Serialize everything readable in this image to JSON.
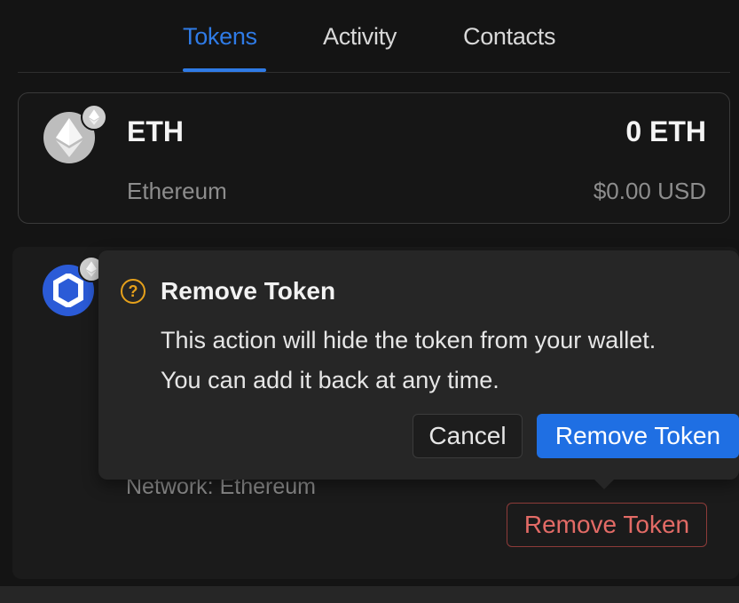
{
  "tabs": [
    {
      "label": "Tokens",
      "active": true
    },
    {
      "label": "Activity",
      "active": false
    },
    {
      "label": "Contacts",
      "active": false
    }
  ],
  "eth_token": {
    "symbol": "ETH",
    "name": "Ethereum",
    "amount": "0 ETH",
    "usd_value": "$0.00 USD",
    "icon": "ethereum-icon",
    "network_badge_icon": "ethereum-network-icon"
  },
  "link_token": {
    "icon": "chainlink-icon",
    "network_badge_icon": "ethereum-network-icon",
    "network": "Network: Ethereum",
    "remove_label": "Remove Token"
  },
  "popover": {
    "icon": "question-icon",
    "title": "Remove Token",
    "message_line1": "This action will hide the token from your wallet.",
    "message_line2": "You can add it back at any time.",
    "cancel_label": "Cancel",
    "confirm_label": "Remove Token"
  },
  "colors": {
    "accent": "#2f7be6",
    "danger": "#e36b66",
    "warning": "#e6a11b",
    "background": "#141414"
  }
}
